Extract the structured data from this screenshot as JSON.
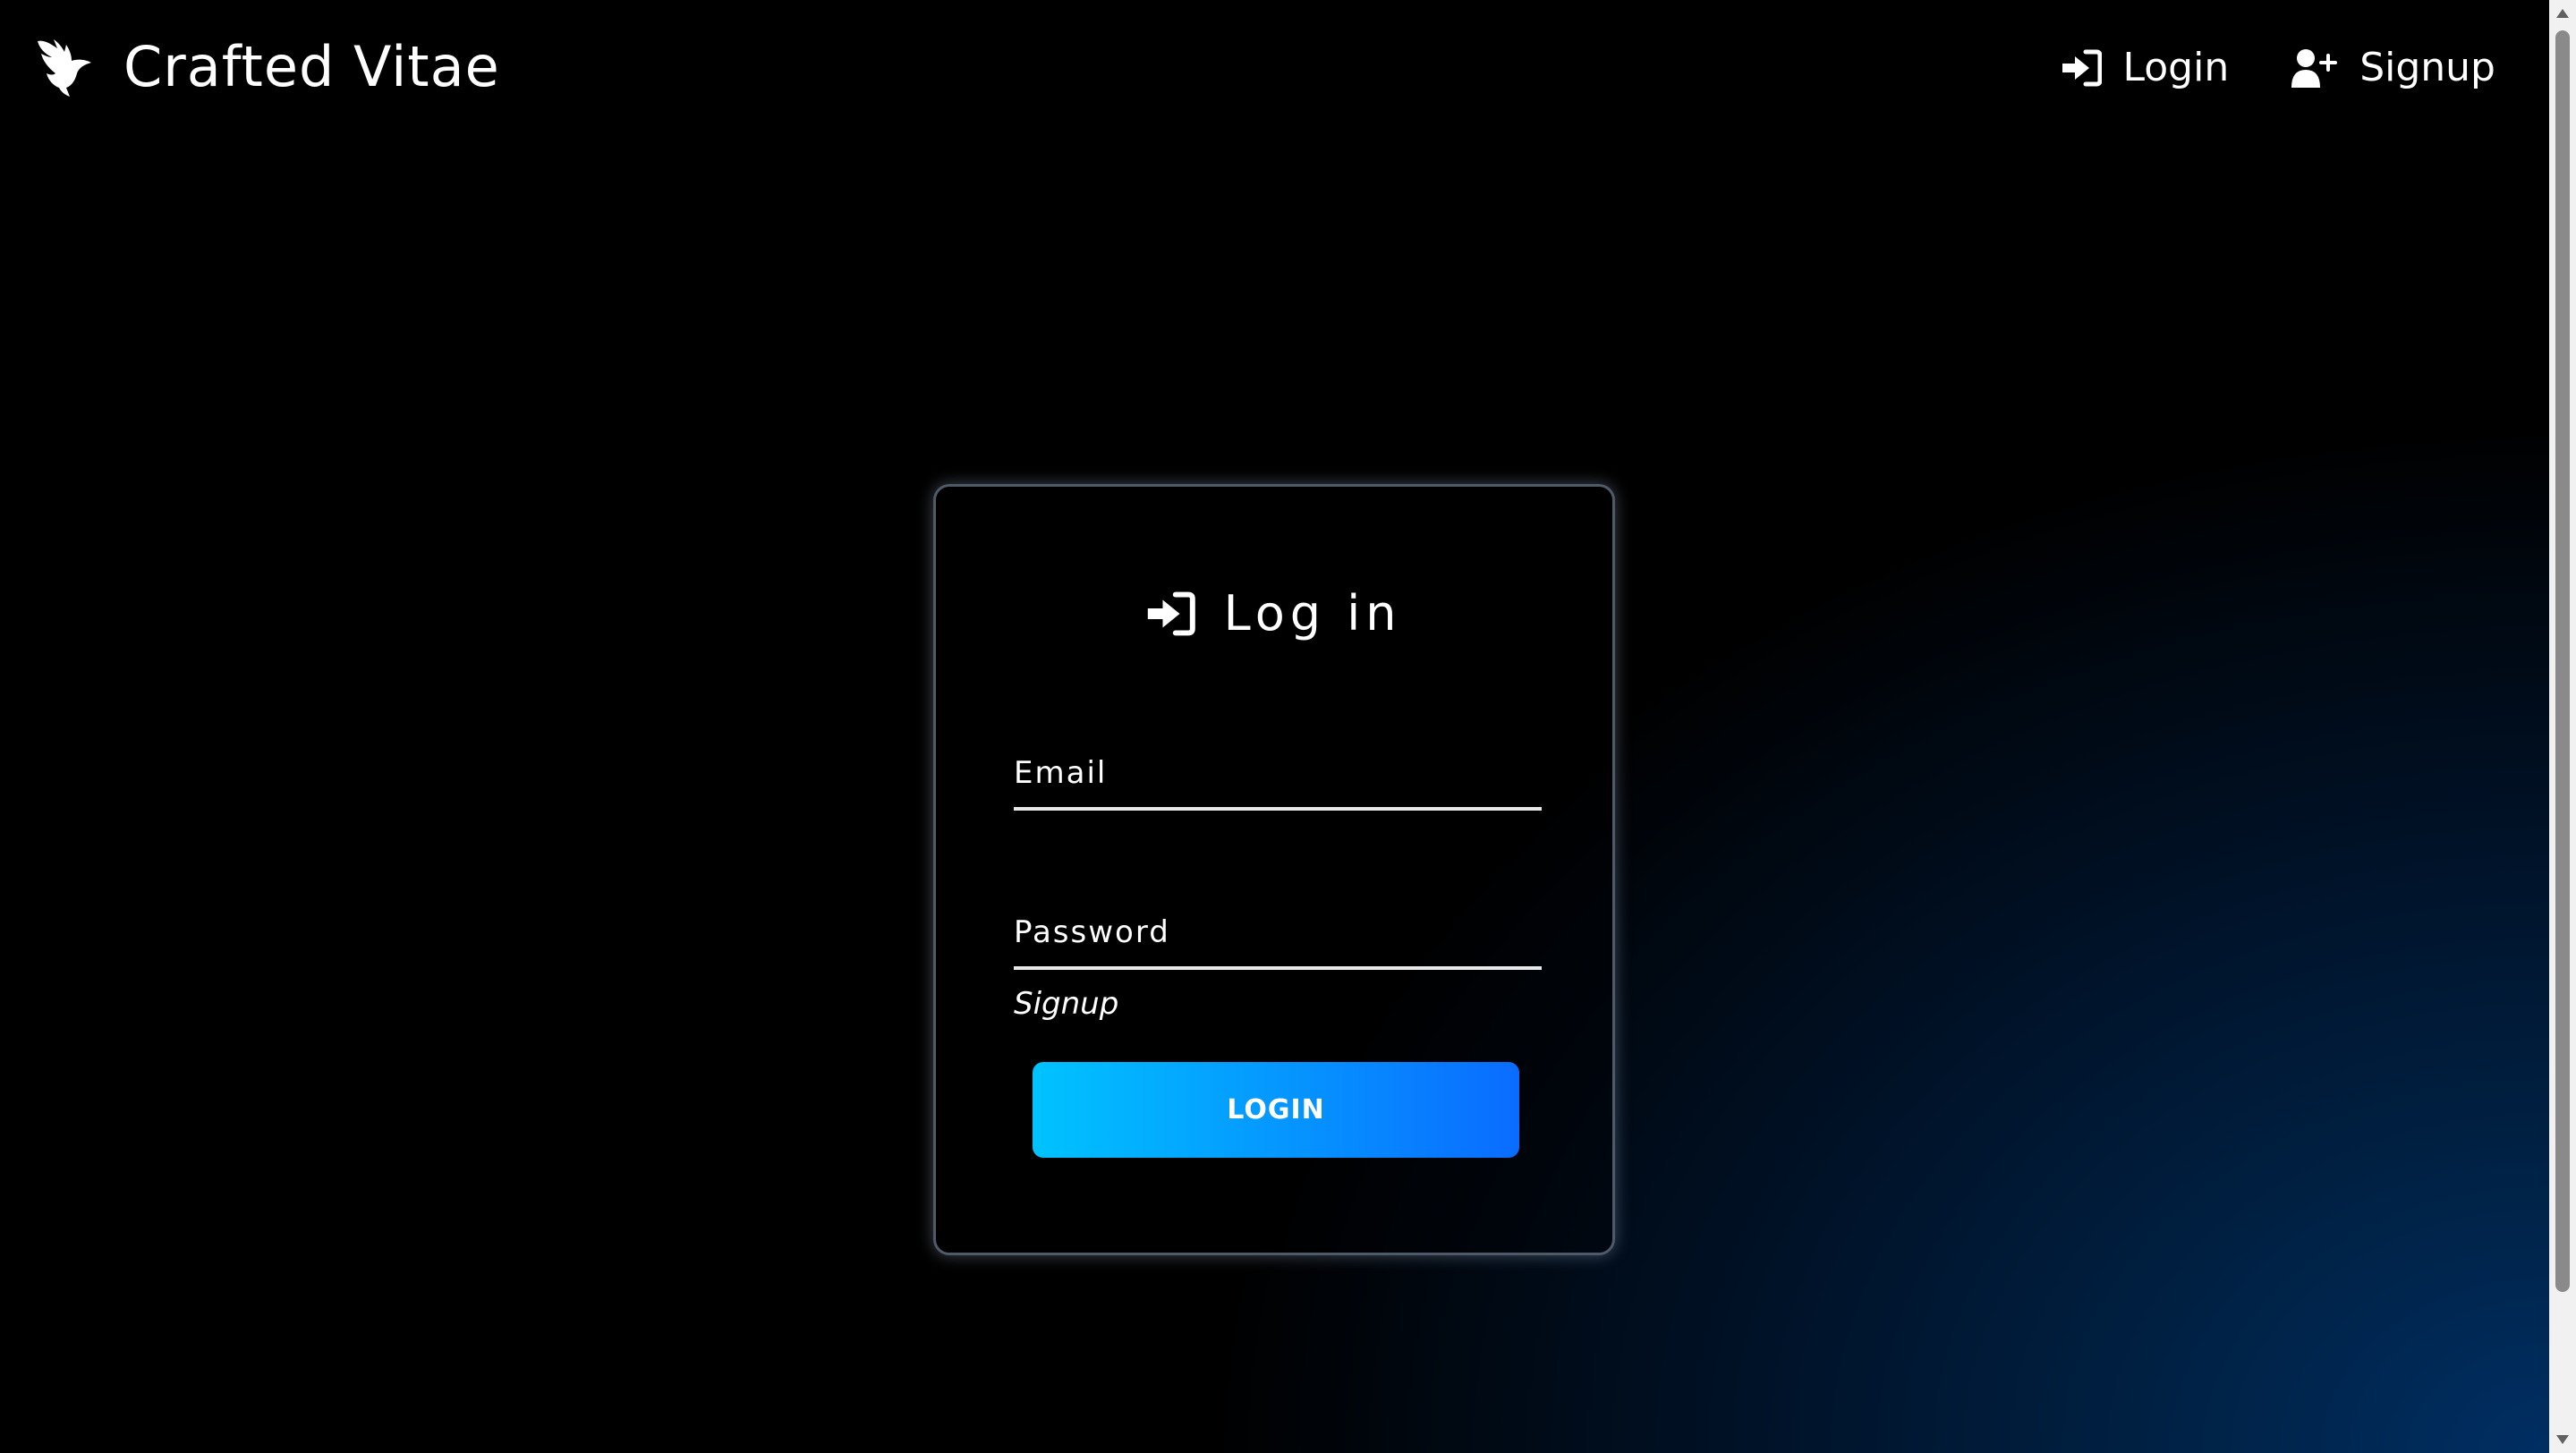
{
  "brand": {
    "title": "Crafted Vitae",
    "logo_icon": "bird-icon"
  },
  "nav": {
    "items": [
      {
        "label": "Login",
        "icon": "sign-in-icon"
      },
      {
        "label": "Signup",
        "icon": "user-plus-icon"
      }
    ]
  },
  "login_card": {
    "title": "Log in",
    "title_icon": "sign-in-icon",
    "email_label": "Email",
    "email_value": "",
    "password_label": "Password",
    "password_value": "",
    "signup_link": "Signup",
    "submit_label": "LOGIN"
  },
  "colors": {
    "background": "#000000",
    "background_glow": "#002e63",
    "button_gradient_start": "#00c3ff",
    "button_gradient_end": "#0a6cff",
    "text": "#ffffff"
  }
}
